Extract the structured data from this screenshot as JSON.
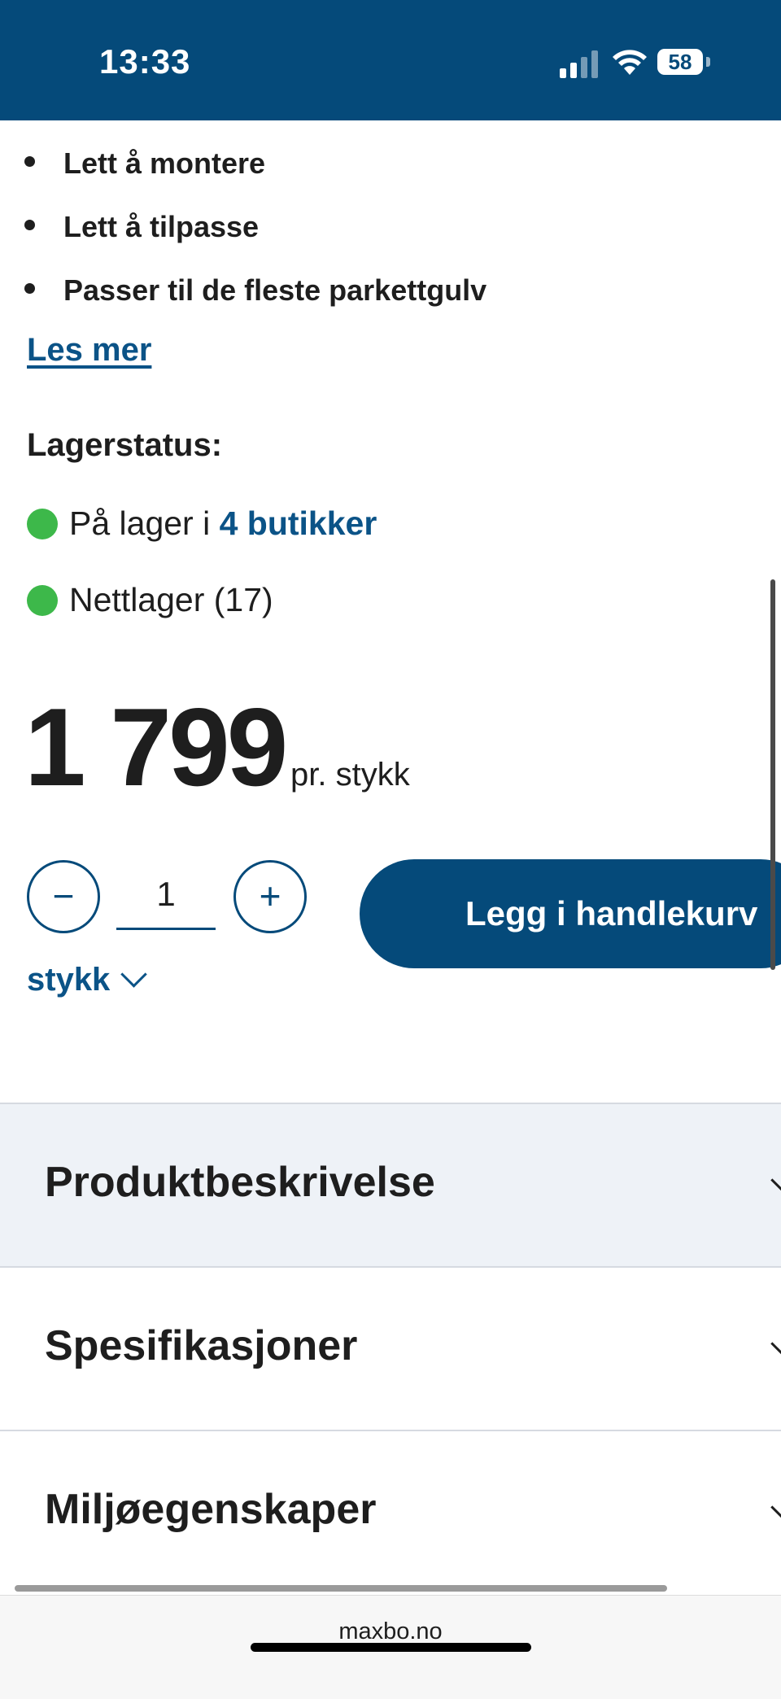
{
  "status_bar": {
    "time": "13:33",
    "battery": "58"
  },
  "features": [
    {
      "text": "Lett å montere"
    },
    {
      "text": "Lett å tilpasse"
    },
    {
      "text": "Passer til de fleste parkettgulv"
    }
  ],
  "read_more": "Les mer",
  "stock": {
    "title": "Lagerstatus:",
    "store_prefix": "På lager i ",
    "store_link": "4 butikker",
    "online": "Nettlager (17)",
    "status_color": "#3db84a"
  },
  "price": {
    "amount": "1 799",
    "unit": "pr. stykk"
  },
  "quantity": {
    "value": "1",
    "minus": "−",
    "plus": "+",
    "unit_select": "stykk"
  },
  "add_to_cart": "Legg i handlekurv",
  "accordion": [
    {
      "label": "Produktbeskrivelse"
    },
    {
      "label": "Spesifikasjoner"
    },
    {
      "label": "Miljøegenskaper"
    }
  ],
  "browser": {
    "url": "maxbo.no"
  },
  "colors": {
    "brand": "#054a7a",
    "link": "#0b5387",
    "accordion_bg": "#eef2f7"
  }
}
